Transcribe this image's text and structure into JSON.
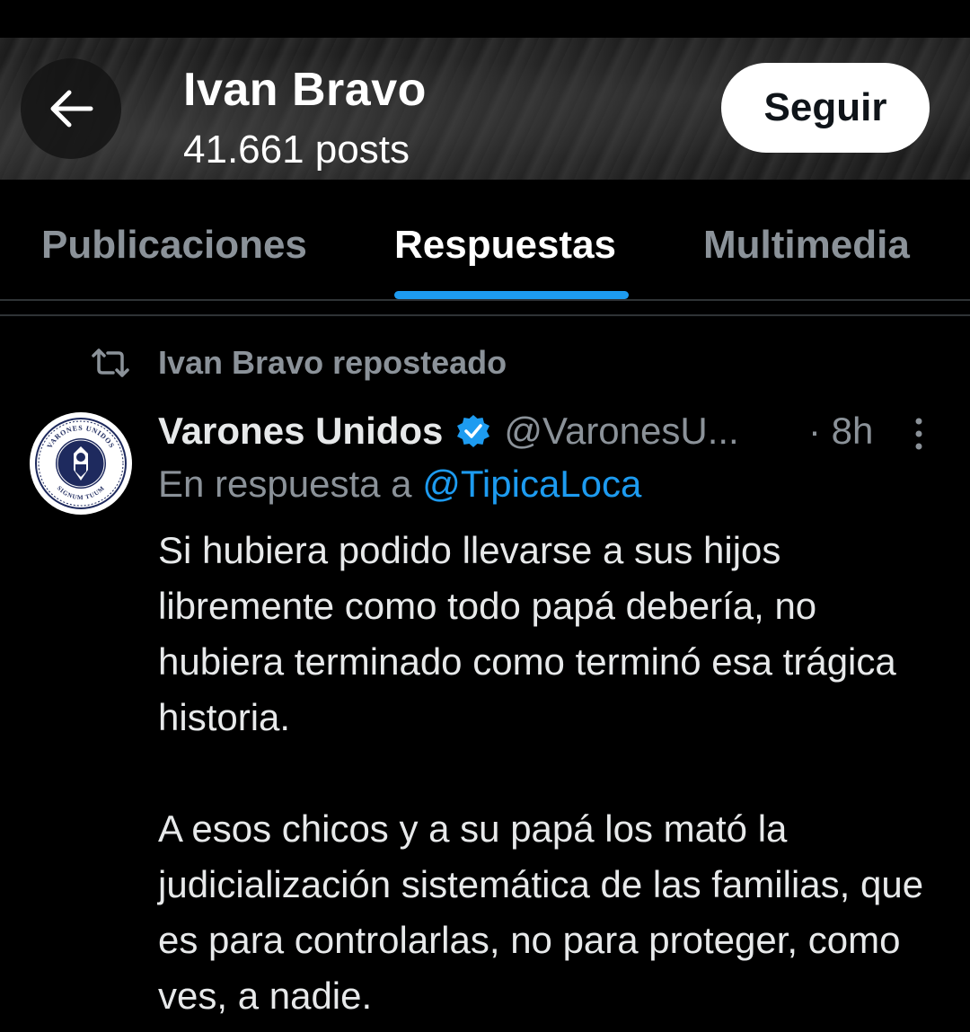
{
  "header": {
    "profile_name": "Ivan Bravo",
    "posts_count": "41.661 posts",
    "follow_label": "Seguir",
    "back_icon": "arrow-left-icon"
  },
  "tabs": [
    {
      "label": "Publicaciones",
      "active": false
    },
    {
      "label": "Respuestas",
      "active": true
    },
    {
      "label": "Multimedia",
      "active": false
    }
  ],
  "repost": {
    "icon": "repost-icon",
    "label": "Ivan Bravo reposteado"
  },
  "tweet": {
    "author_name": "Varones Unidos",
    "verified": true,
    "handle": "@VaronesU...",
    "time": "· 8h",
    "reply_prefix": "En respuesta a ",
    "reply_handle": "@TipicaLoca",
    "paragraphs": [
      "Si hubiera podido llevarse a sus hijos libremente como todo papá debería, no hubiera terminado como terminó esa trágica historia.",
      "A esos chicos y a su papá los mató la judicialización sistemática de las familias, que es para controlarlas, no para proteger, como ves, a nadie."
    ],
    "avatar": {
      "top_text": "VARONES UNIDOS",
      "bottom_text": "SIGNUM TUUM"
    }
  },
  "colors": {
    "accent": "#1d9bf0",
    "text": "#e7e9ea",
    "muted": "#8b9299",
    "background": "#000000"
  }
}
